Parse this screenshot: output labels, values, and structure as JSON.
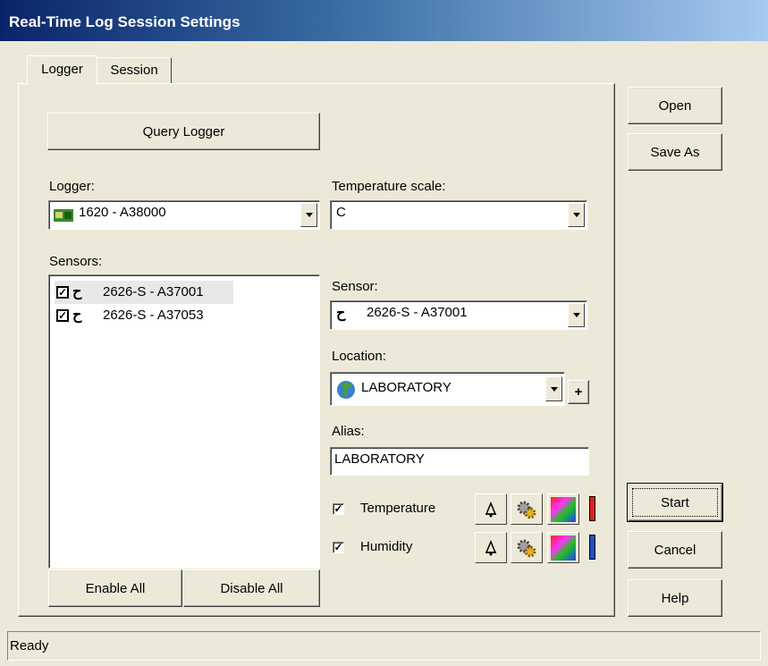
{
  "window": {
    "title": "Real-Time Log Session Settings"
  },
  "tabs": [
    {
      "label": "Logger"
    },
    {
      "label": "Session"
    }
  ],
  "logger_tab": {
    "query_button": "Query Logger",
    "logger_label": "Logger:",
    "logger_value": "1620 - A38000",
    "temp_scale_label": "Temperature scale:",
    "temp_scale_value": "C",
    "sensors_label": "Sensors:",
    "sensors": [
      {
        "label": "2626-S - A37001",
        "checked": true,
        "selected": true
      },
      {
        "label": "2626-S - A37053",
        "checked": true,
        "selected": false
      }
    ],
    "enable_all": "Enable All",
    "disable_all": "Disable All",
    "sensor_label": "Sensor:",
    "sensor_value": "2626-S - A37001",
    "location_label": "Location:",
    "location_value": "LABORATORY",
    "location_add": "+",
    "alias_label": "Alias:",
    "alias_value": "LABORATORY",
    "channels": [
      {
        "label": "Temperature",
        "checked": true,
        "color": "#e02020"
      },
      {
        "label": "Humidity",
        "checked": true,
        "color": "#2050c0"
      }
    ]
  },
  "side_buttons": {
    "open": "Open",
    "save_as": "Save As",
    "start": "Start",
    "cancel": "Cancel",
    "help": "Help"
  },
  "status": "Ready"
}
